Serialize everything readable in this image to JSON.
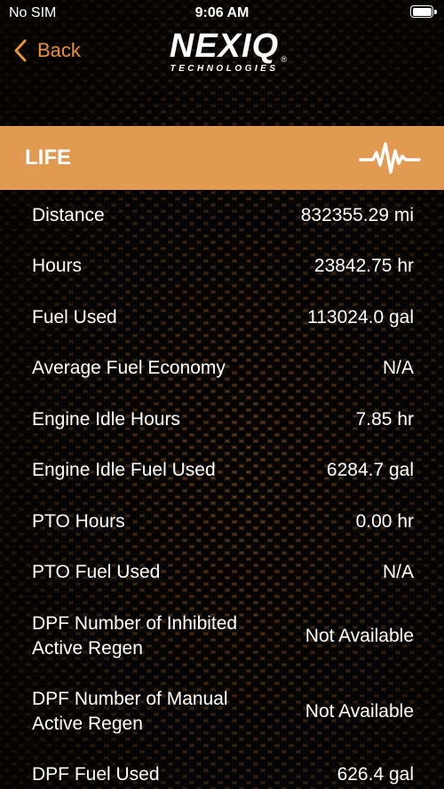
{
  "status_bar": {
    "carrier": "No SIM",
    "time": "9:06 AM"
  },
  "nav": {
    "back_label": "Back",
    "logo_text": "NEXIQ",
    "logo_subtext": "TECHNOLOGIES",
    "logo_reg": "®"
  },
  "section": {
    "title": "LIFE",
    "icon": "pulse-icon"
  },
  "rows": [
    {
      "label": "Distance",
      "value": "832355.29 mi"
    },
    {
      "label": "Hours",
      "value": "23842.75 hr"
    },
    {
      "label": "Fuel Used",
      "value": "113024.0 gal"
    },
    {
      "label": "Average Fuel Economy",
      "value": "N/A"
    },
    {
      "label": "Engine Idle Hours",
      "value": "7.85 hr"
    },
    {
      "label": "Engine Idle Fuel Used",
      "value": "6284.7 gal"
    },
    {
      "label": "PTO Hours",
      "value": "0.00 hr"
    },
    {
      "label": "PTO Fuel Used",
      "value": "N/A"
    },
    {
      "label": "DPF Number of Inhibited Active Regen",
      "value": "Not Available"
    },
    {
      "label": "DPF Number of Manual Active Regen",
      "value": "Not Available"
    },
    {
      "label": "DPF Fuel Used",
      "value": "626.4 gal"
    }
  ],
  "colors": {
    "accent": "#e8923a",
    "header_bg": "#e29a52"
  }
}
